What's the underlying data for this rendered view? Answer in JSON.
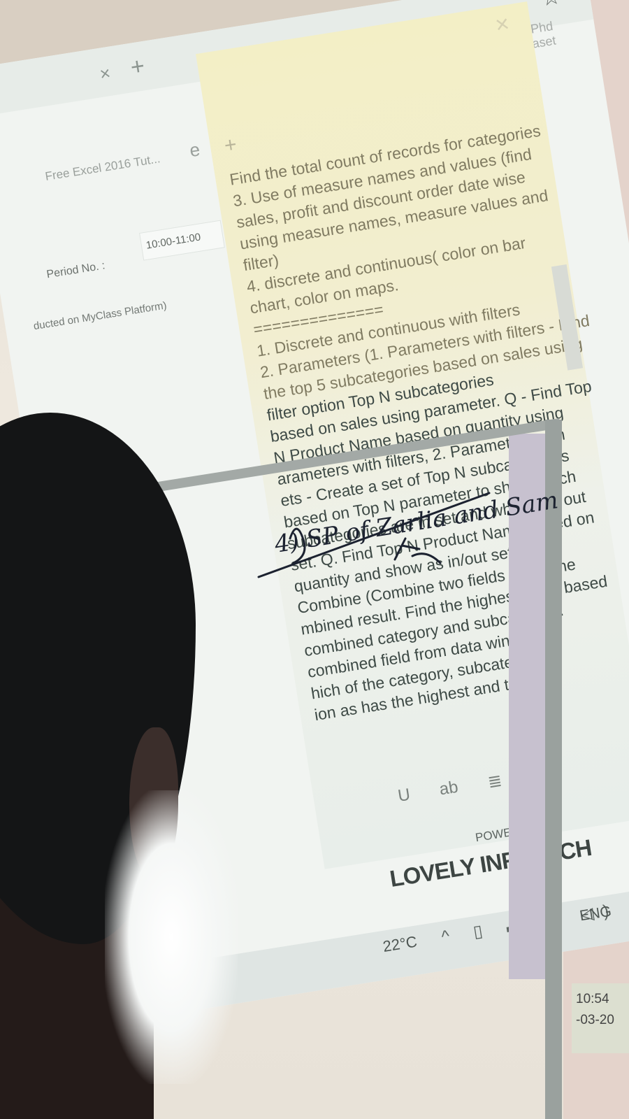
{
  "browser": {
    "tab_close": "×",
    "tab_add": "+",
    "bookmark_left": "Free Excel 2016 Tut...",
    "bookmark_right": "My Phd Dataset",
    "star_icon": "star-icon",
    "time_field": "10:00-11:00",
    "period_label": "Period No. :",
    "platform_text": "ducted on MyClass Platform)"
  },
  "note": {
    "plus": "+",
    "close": "×",
    "upper_lines": [
      "Find the total count of records for categories",
      "3. Use of measure names and values (find",
      "sales, profit and discount order date wise",
      "using measure names, measure values and",
      "filter)",
      "4. discrete and continuous( color on bar",
      "chart, color on maps.",
      "==============",
      "1. Discrete and continuous with filters",
      "2. Parameters (1. Parameters with filters - Find",
      "the top 5 subcategories based on sales using"
    ],
    "lower_lines": [
      "filter option Top N subcategories",
      "based on sales using parameter. Q - Find Top",
      "N Product Name based on quantity using",
      "arameters with filters, 2. Parameters with",
      "ets - Create a set of Top N subcategories",
      "based on Top N parameter to show which",
      "subcategories are in set and which are out",
      "set. Q. Find Top N Product Name based on",
      "quantity and show as in/out set)",
      "Combine (Combine two fields to get the",
      "mbined result. Find the highest sales based",
      "combined category and subcategory.",
      "combined field from data window.",
      "hich of the category, subcategory",
      "ion as has the highest and the"
    ],
    "toolbar": {
      "underline": "U",
      "strike": "ab",
      "list": "≣",
      "image_icon": "image-icon"
    }
  },
  "footer": {
    "powered_by": "POWERED BY",
    "brand": "LOVELY INFOTECH"
  },
  "taskbar": {
    "temperature": "22°C",
    "tray": "^ ▯ ▬ ◔ ◁)",
    "language": "ENG"
  },
  "clock": {
    "time": "10:54",
    "date": "-03-20"
  },
  "handwriting": {
    "text": "4) SP of Zarlia and Sam"
  }
}
